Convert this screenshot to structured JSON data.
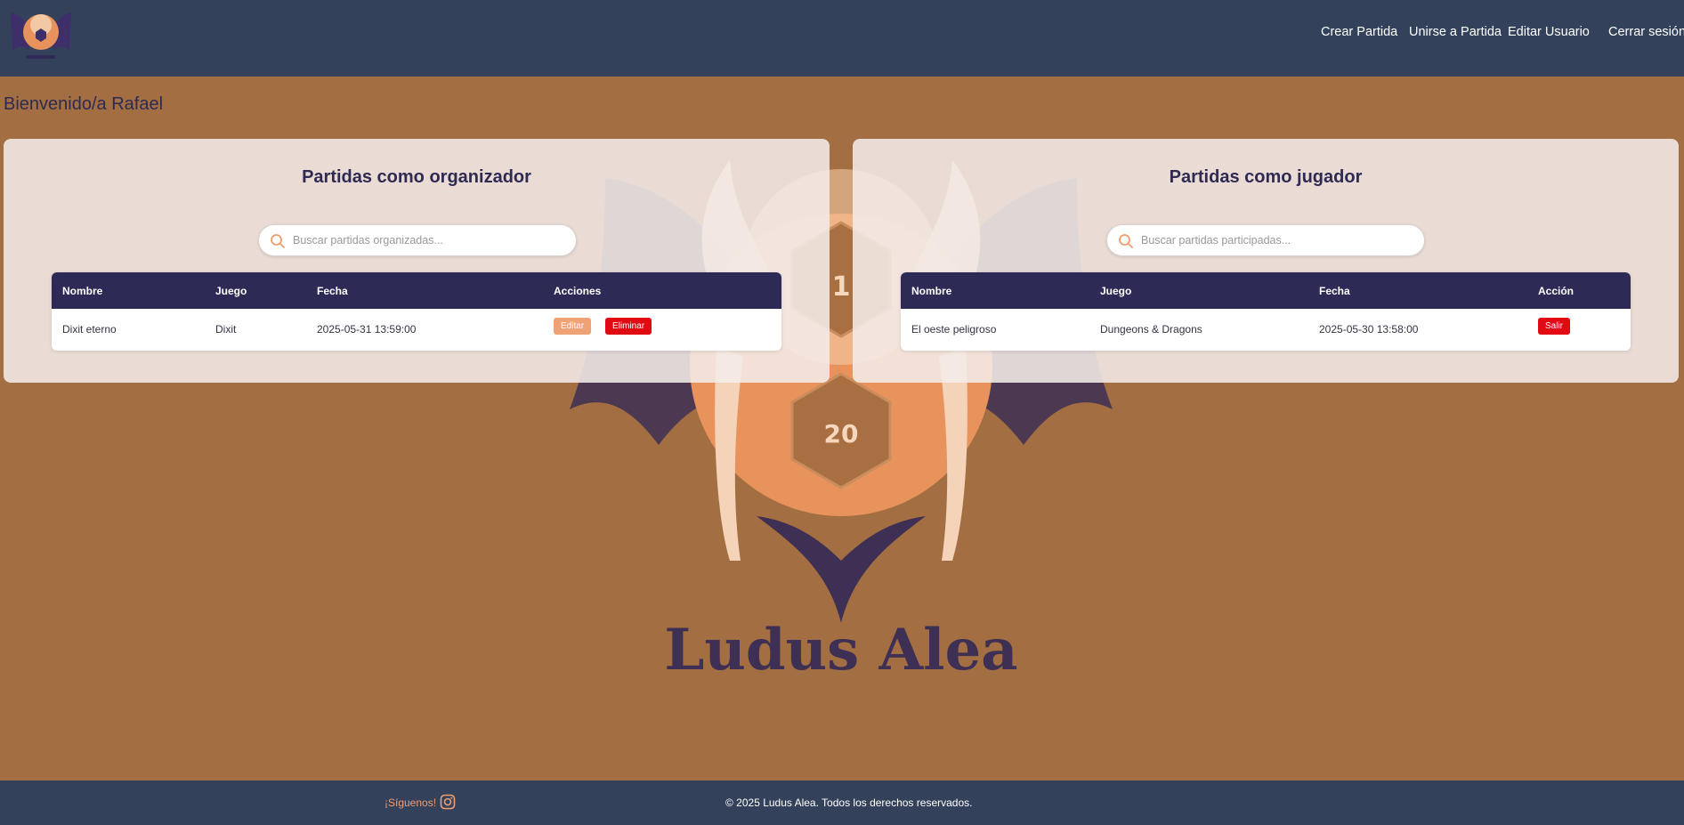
{
  "nav": {
    "links": [
      "Crear Partida",
      "Unirse a Partida",
      "Editar Usuario",
      "Cerrar sesión"
    ]
  },
  "welcome": "Bienvenido/a Rafael",
  "watermark": {
    "text": "Ludus Alea",
    "die_top": "1",
    "die_bottom": "20"
  },
  "organizer": {
    "title": "Partidas como organizador",
    "search_placeholder": "Buscar partidas organizadas...",
    "headers": [
      "Nombre",
      "Juego",
      "Fecha",
      "Acciones"
    ],
    "rows": [
      {
        "nombre": "Dixit eterno",
        "juego": "Dixit",
        "fecha": "2025-05-31 13:59:00",
        "edit": "Editar",
        "delete": "Eliminar"
      }
    ]
  },
  "player": {
    "title": "Partidas como jugador",
    "search_placeholder": "Buscar partidas participadas...",
    "headers": [
      "Nombre",
      "Juego",
      "Fecha",
      "Acción"
    ],
    "rows": [
      {
        "nombre": "El oeste peligroso",
        "juego": "Dungeons & Dragons",
        "fecha": "2025-05-30 13:58:00",
        "leave": "Salir"
      }
    ]
  },
  "footer": {
    "follow": "¡Síguenos!",
    "copyright": "© 2025 Ludus Alea. Todos los derechos reservados."
  },
  "colors": {
    "header_bg": "#33425a",
    "page_bg": "#a36e41",
    "table_head": "#2d2a55",
    "accent": "#f0a277",
    "danger": "#e10a13",
    "text_dark": "#2e2a52"
  },
  "icons": [
    "brand-logo",
    "search-icon",
    "instagram-icon"
  ]
}
